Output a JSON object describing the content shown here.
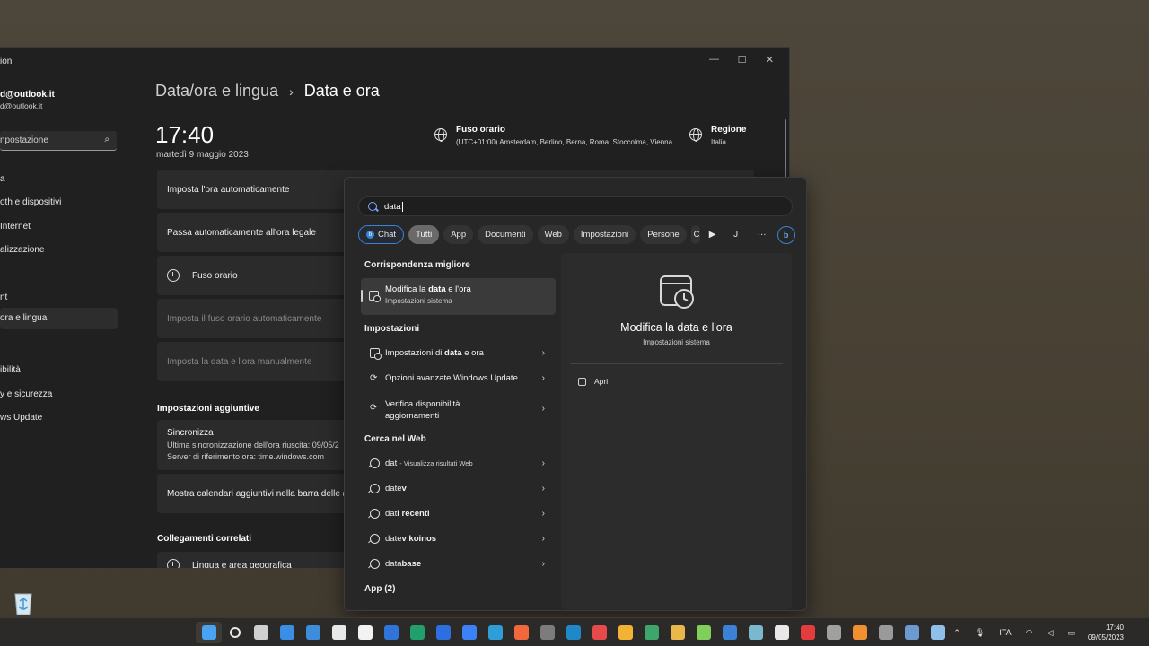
{
  "settings": {
    "window_title": "ioni",
    "account_name": "d@outlook.it",
    "account_email": "d@outlook.it",
    "search_placeholder": "npostazione",
    "nav": [
      {
        "label": "a"
      },
      {
        "label": "oth e dispositivi"
      },
      {
        "label": "Internet"
      },
      {
        "label": "alizzazione"
      },
      {
        "label": "nt"
      },
      {
        "label": "ora e lingua"
      },
      {
        "label": "ibilità"
      },
      {
        "label": "y e sicurezza"
      },
      {
        "label": "ws Update"
      }
    ],
    "breadcrumb_parent": "Data/ora e lingua",
    "breadcrumb_sep": "›",
    "breadcrumb_current": "Data e ora",
    "time": "17:40",
    "date": "martedì 9 maggio 2023",
    "timezone_title": "Fuso orario",
    "timezone_value": "(UTC+01:00) Amsterdam, Berlino, Berna, Roma, Stoccolma, Vienna",
    "region_title": "Regione",
    "region_value": "Italia",
    "cards": {
      "auto_time": "Imposta l'ora automaticamente",
      "dst": "Passa automaticamente all'ora legale",
      "timezone": "Fuso orario",
      "auto_timezone": "Imposta il fuso orario automaticamente",
      "manual": "Imposta la data e l'ora manualmente",
      "calendars": "Mostra calendari aggiuntivi nella barra delle app"
    },
    "additional_header": "Impostazioni aggiuntive",
    "sync_title": "Sincronizza",
    "sync_last": "Ultima sincronizzazione dell'ora riuscita: 09/05/2",
    "sync_server": "Server di riferimento ora: time.windows.com",
    "related_header": "Collegamenti correlati",
    "related_language": "Lingua e area geografica"
  },
  "search": {
    "query": "data",
    "filters": [
      "Chat",
      "Tutti",
      "App",
      "Documenti",
      "Web",
      "Impostazioni",
      "Persone"
    ],
    "cut_chip": "C",
    "avatar": "J",
    "more": "···",
    "best_match_header": "Corrispondenza migliore",
    "best_match_title_pre": "Modifica la ",
    "best_match_title_bold": "data",
    "best_match_title_post": " e l'ora",
    "best_match_sub": "Impostazioni sistema",
    "settings_header": "Impostazioni",
    "settings_items": [
      {
        "pre": "Impostazioni di ",
        "bold": "data",
        "post": " e ora"
      },
      {
        "pre": "Opzioni avanzate Windows Update",
        "bold": "",
        "post": ""
      },
      {
        "pre": "Verifica disponibilità aggiornamenti",
        "bold": "",
        "post": ""
      }
    ],
    "web_header": "Cerca nel Web",
    "web_items": [
      {
        "pre": "dat",
        "bold": "",
        "sub": "- Visualizza risultati Web"
      },
      {
        "pre": "date",
        "bold": "v",
        "sub": ""
      },
      {
        "pre": "dat",
        "bold": "i recenti",
        "sub": ""
      },
      {
        "pre": "date",
        "bold": "v koinos",
        "sub": ""
      },
      {
        "pre": "data",
        "bold": "base",
        "sub": ""
      }
    ],
    "apps_header": "App (2)",
    "preview_title": "Modifica la data e l'ora",
    "preview_sub": "Impostazioni sistema",
    "open_label": "Apri"
  },
  "taskbar": {
    "lang": "ITA",
    "time": "17:40",
    "date": "09/05/2023",
    "app_colors": [
      "#4aa3f0",
      "#e8e8e8",
      "#cfcfcf",
      "#3b8ee6",
      "#3d8ddc",
      "#e8e8e8",
      "#f2f2f2",
      "#2f74d9",
      "#22a06b",
      "#2d6ee0",
      "#3b82f6",
      "#2f9ed8",
      "#f0683c",
      "#7c7c7c",
      "#1e88c8",
      "#e64a4a",
      "#f2b233",
      "#3ea66b",
      "#e8b84a",
      "#7fcf5a",
      "#3b82d6",
      "#7ab8d0",
      "#e8e8e8",
      "#e23c3c",
      "#a0a0a0",
      "#f09030",
      "#9a9a9a",
      "#6a9ad0",
      "#8ec0e8"
    ]
  }
}
